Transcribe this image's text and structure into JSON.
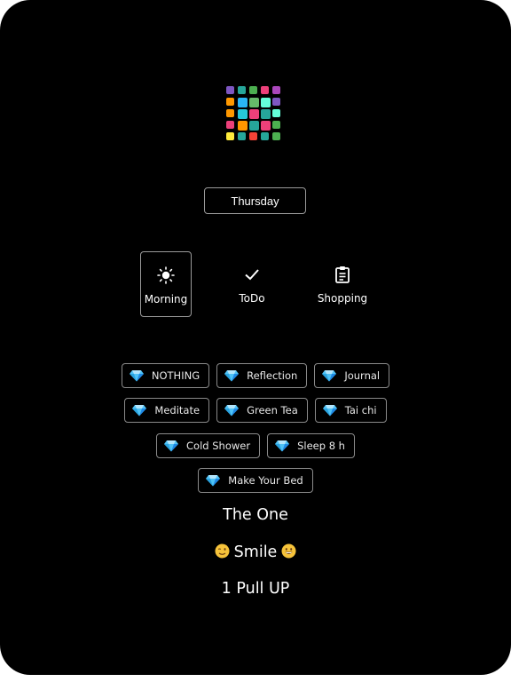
{
  "logo": {
    "name": "app-logo",
    "colors": [
      "#7e57c2",
      "#26a69a",
      "#4caf50",
      "#ec407a",
      "#ab47bc",
      "#ff9800",
      "#29b6f6",
      "#66bb6a",
      "#64ffda",
      "#7e57c2",
      "#ff9800",
      "#26c6da",
      "#ec407a",
      "#26a69a",
      "#64ffda",
      "#ec407a",
      "#ff9800",
      "#26a69a",
      "#ec407a",
      "#4caf50",
      "#ffeb3b",
      "#26a69a",
      "#f44336",
      "#26a69a",
      "#4caf50"
    ]
  },
  "header": {
    "day_label": "Thursday"
  },
  "modes": [
    {
      "label": "Morning",
      "icon": "sun-icon",
      "active": true
    },
    {
      "label": "ToDo",
      "icon": "checkmark-icon",
      "active": false
    },
    {
      "label": "Shopping",
      "icon": "clipboard-icon",
      "active": false
    }
  ],
  "habits": {
    "icon": "diamond-icon",
    "row1": [
      "NOTHING",
      "Reflection",
      "Journal"
    ],
    "row2": [
      "Meditate",
      "Green Tea",
      "Tai chi"
    ],
    "row3": [
      "Cold Shower",
      "Sleep 8 h"
    ],
    "row4": [
      "Make Your Bed"
    ]
  },
  "focus": {
    "the_one": "The One",
    "smile": "Smile",
    "smile_left_emoji": "winking-face-icon",
    "smile_right_emoji": "grinning-face-icon",
    "pull_up": "1 Pull UP"
  },
  "colors": {
    "background": "#000000",
    "border": "#9a9a9a",
    "text": "#ffffff"
  }
}
